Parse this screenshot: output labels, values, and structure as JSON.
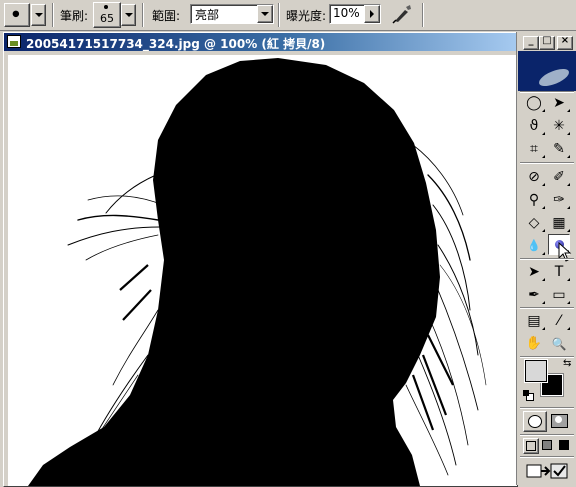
{
  "options_bar": {
    "brush_label": "筆刷:",
    "brush_size": "65",
    "range_label": "範圍:",
    "range_value": "亮部",
    "exposure_label": "曝光度:",
    "exposure_value": "10%"
  },
  "document": {
    "title": "20054171517734_324.jpg @ 100% (紅 拷貝/8)",
    "image_description_colors": {
      "background": "#ffffff",
      "silhouette": "#000000"
    }
  },
  "toolbox": {
    "window_buttons": [
      "_",
      "□",
      "×"
    ],
    "tools": [
      {
        "name": "marquee",
        "glyph": "◯"
      },
      {
        "name": "move",
        "glyph": "➤"
      },
      {
        "name": "lasso",
        "glyph": "ϑ"
      },
      {
        "name": "magic-wand",
        "glyph": "✳"
      },
      {
        "name": "crop",
        "glyph": "⌗"
      },
      {
        "name": "slice",
        "glyph": "✎"
      },
      {
        "name": "healing-brush",
        "glyph": "⊘"
      },
      {
        "name": "brush",
        "glyph": "✐"
      },
      {
        "name": "clone-stamp",
        "glyph": "⚲"
      },
      {
        "name": "history-brush",
        "glyph": "✑"
      },
      {
        "name": "eraser",
        "glyph": "◇"
      },
      {
        "name": "gradient",
        "glyph": "▦"
      },
      {
        "name": "blur",
        "glyph": "💧"
      },
      {
        "name": "dodge",
        "glyph": "●"
      },
      {
        "name": "path-selection",
        "glyph": "➤"
      },
      {
        "name": "type",
        "glyph": "T"
      },
      {
        "name": "pen",
        "glyph": "✒"
      },
      {
        "name": "shape",
        "glyph": "▭"
      },
      {
        "name": "notes",
        "glyph": "▤"
      },
      {
        "name": "eyedropper",
        "glyph": "⁄"
      },
      {
        "name": "hand",
        "glyph": "✋"
      },
      {
        "name": "zoom",
        "glyph": "🔍"
      }
    ],
    "foreground_color": "#d8d8d8",
    "background_color": "#000000"
  }
}
